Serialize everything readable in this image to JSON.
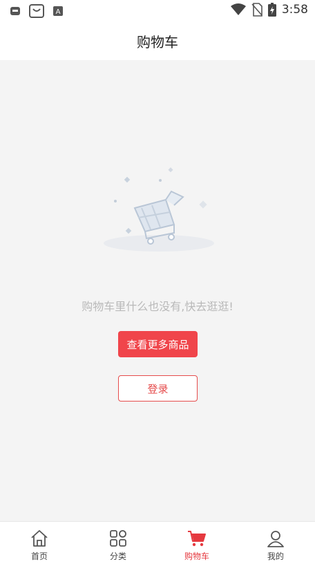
{
  "status": {
    "time": "3:58"
  },
  "header": {
    "title": "购物车"
  },
  "empty": {
    "message": "购物车里什么也没有,快去逛逛!"
  },
  "buttons": {
    "more": "查看更多商品",
    "login": "登录"
  },
  "tabs": [
    {
      "label": "首页",
      "icon": "home-icon"
    },
    {
      "label": "分类",
      "icon": "category-icon"
    },
    {
      "label": "购物车",
      "icon": "cart-icon",
      "active": true
    },
    {
      "label": "我的",
      "icon": "user-icon"
    }
  ],
  "colors": {
    "accent": "#f0454b",
    "background": "#f4f4f4"
  }
}
